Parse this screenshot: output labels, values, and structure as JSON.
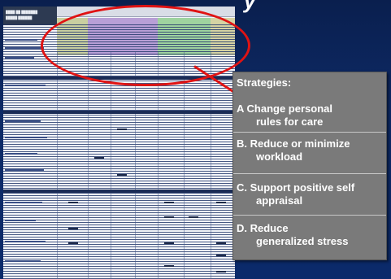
{
  "slide": {
    "title_fragment": "y"
  },
  "spreadsheet": {
    "header_lines": [
      "████ ██ ███████",
      "█████ ██████"
    ]
  },
  "strategies": {
    "title": "Strategies:",
    "items": [
      {
        "line1": "A Change personal",
        "line2": "rules for care"
      },
      {
        "line1": "B. Reduce or minimize",
        "line2": "workload"
      },
      {
        "line1": "C. Support positive self",
        "line2": "appraisal"
      },
      {
        "line1": "D. Reduce",
        "line2": "generalized stress"
      }
    ]
  },
  "colors": {
    "background": "#0d2a66",
    "highlight": "#e01313",
    "callout": "#7a7a7a",
    "purple_block": "#b89fd6",
    "green_block": "#9fd39f",
    "olive_block": "#c9cfa0"
  }
}
